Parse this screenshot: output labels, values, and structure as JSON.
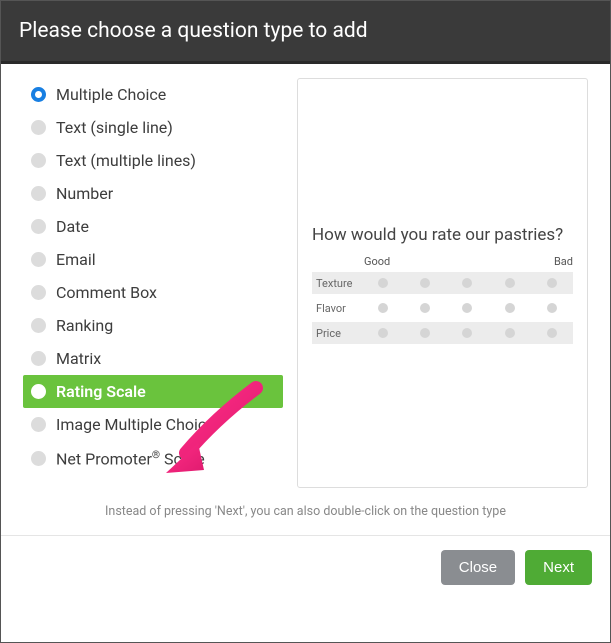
{
  "modal": {
    "title": "Please choose a question type to add",
    "hint": "Instead of pressing 'Next', you can also double-click on the question type",
    "close": "Close",
    "next": "Next"
  },
  "types": [
    {
      "label": "Multiple Choice"
    },
    {
      "label": "Text (single line)"
    },
    {
      "label": "Text (multiple lines)"
    },
    {
      "label": "Number"
    },
    {
      "label": "Date"
    },
    {
      "label": "Email"
    },
    {
      "label": "Comment Box"
    },
    {
      "label": "Ranking"
    },
    {
      "label": "Matrix"
    },
    {
      "label": "Rating Scale"
    },
    {
      "label": "Image Multiple Choice"
    },
    {
      "label": "Net Promoter® Score"
    }
  ],
  "preview": {
    "question": "How would you rate our pastries?",
    "scaleLeft": "Good",
    "scaleRight": "Bad",
    "rows": [
      "Texture",
      "Flavor",
      "Price"
    ]
  }
}
